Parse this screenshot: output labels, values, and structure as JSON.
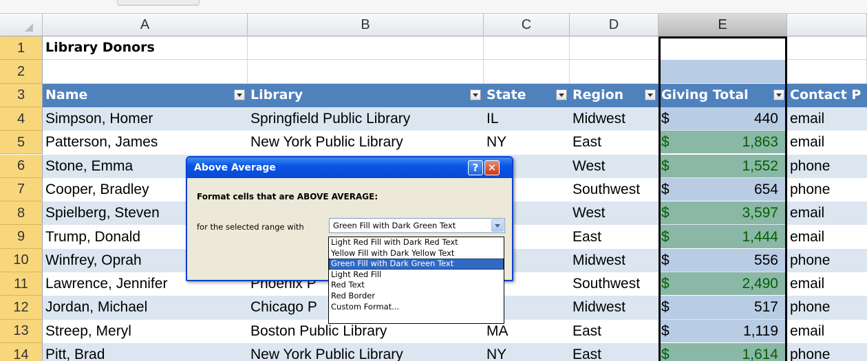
{
  "columns": [
    "A",
    "B",
    "C",
    "D",
    "E"
  ],
  "row_numbers": [
    "1",
    "2",
    "3",
    "4",
    "5",
    "6",
    "7",
    "8",
    "9",
    "10",
    "11",
    "12",
    "13",
    "14"
  ],
  "sheet": {
    "title": "Library Donors",
    "headers": [
      "Name",
      "Library",
      "State",
      "Region",
      "Giving Total",
      "Contact P"
    ],
    "rows": [
      {
        "name": "Simpson, Homer",
        "library": "Springfield Public Library",
        "state": "IL",
        "region": "Midwest",
        "currency": "$",
        "total": "440",
        "contact": "email",
        "above_average": false
      },
      {
        "name": "Patterson, James",
        "library": "New York Public Library",
        "state": "NY",
        "region": "East",
        "currency": "$",
        "total": "1,863",
        "contact": "email",
        "above_average": true
      },
      {
        "name": "Stone, Emma",
        "library": "",
        "state": "",
        "region": "West",
        "currency": "$",
        "total": "1,552",
        "contact": "phone",
        "above_average": true
      },
      {
        "name": "Cooper, Bradley",
        "library": "",
        "state": "",
        "region": "Southwest",
        "currency": "$",
        "total": "654",
        "contact": "phone",
        "above_average": false
      },
      {
        "name": "Spielberg, Steven",
        "library": "",
        "state": "",
        "region": "West",
        "currency": "$",
        "total": "3,597",
        "contact": "email",
        "above_average": true
      },
      {
        "name": "Trump, Donald",
        "library": "",
        "state": "",
        "region": "East",
        "currency": "$",
        "total": "1,444",
        "contact": "email",
        "above_average": true
      },
      {
        "name": "Winfrey, Oprah",
        "library": "",
        "state": "",
        "region": "Midwest",
        "currency": "$",
        "total": "556",
        "contact": "phone",
        "above_average": false
      },
      {
        "name": "Lawrence, Jennifer",
        "library": "Phoenix P",
        "state": "Z",
        "region": "Southwest",
        "currency": "$",
        "total": "2,490",
        "contact": "email",
        "above_average": true
      },
      {
        "name": "Jordan, Michael",
        "library": "Chicago P",
        "state": "",
        "region": "Midwest",
        "currency": "$",
        "total": "517",
        "contact": "phone",
        "above_average": false
      },
      {
        "name": "Streep, Meryl",
        "library": "Boston Public Library",
        "state": "MA",
        "region": "East",
        "currency": "$",
        "total": "1,119",
        "contact": "email",
        "above_average": false
      },
      {
        "name": "Pitt, Brad",
        "library": "New York Public Library",
        "state": "NY",
        "region": "East",
        "currency": "$",
        "total": "1,614",
        "contact": "phone",
        "above_average": true
      }
    ]
  },
  "dialog": {
    "title": "Above Average",
    "help_glyph": "?",
    "close_glyph": "✕",
    "heading": "Format cells that are ABOVE AVERAGE:",
    "label": "for the selected range with",
    "selected": "Green Fill with Dark Green Text",
    "options": [
      "Light Red Fill with Dark Red Text",
      "Yellow Fill with Dark Yellow Text",
      "Green Fill with Dark Green Text",
      "Light Red Fill",
      "Red Text",
      "Red Border",
      "Custom Format..."
    ]
  },
  "colors": {
    "table_header": "#4f81bd",
    "band_light": "#dce6f1",
    "selection": "#b8cce4",
    "green_fill": "#8ab7a6",
    "dark_green_text": "#006100",
    "dialog_title": "#0a56e5"
  },
  "icons": [
    "filter-dropdown-icon",
    "help-icon",
    "close-icon",
    "dropdown-arrow-icon",
    "select-all-icon"
  ]
}
